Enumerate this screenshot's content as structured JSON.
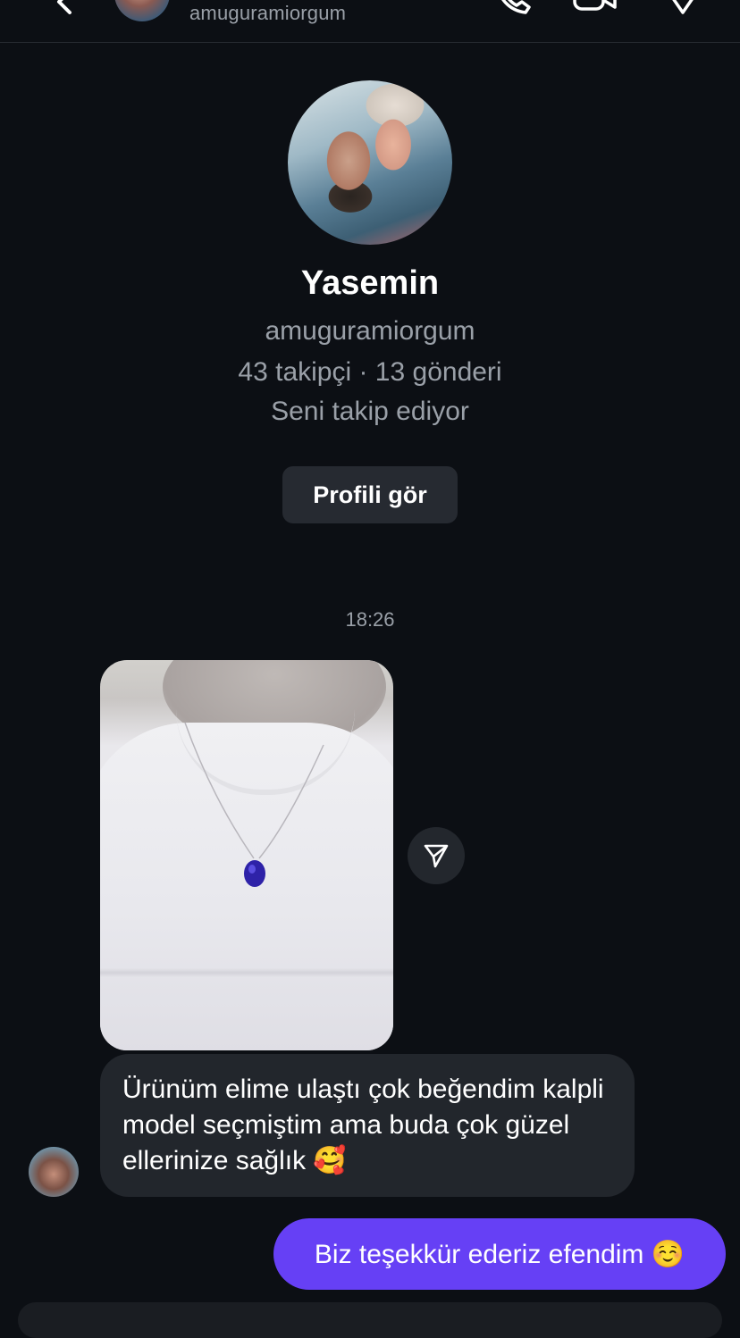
{
  "header": {
    "username": "amuguramiorgum",
    "icons": [
      "back-icon",
      "phone-icon",
      "video-camera-icon",
      "info-icon"
    ]
  },
  "profile": {
    "display_name": "Yasemin",
    "username": "amuguramiorgum",
    "stats": "43 takipçi · 13 gönderi",
    "follow_status": "Seni takip ediyor",
    "view_profile_label": "Profili gör"
  },
  "conversation": {
    "timestamp": "18:26",
    "incoming_text": "Ürünüm elime ulaştı çok beğendim kalpli model seçmiştim ama buda çok güzel ellerinize sağlık 🥰",
    "outgoing_text": "Biz teşekkür ederiz efendim ☺️"
  },
  "colors": {
    "background": "#0c0f14",
    "incoming_bubble": "#22262c",
    "outgoing_bubble": "#6640f5",
    "secondary_text": "#9aa0a8"
  }
}
